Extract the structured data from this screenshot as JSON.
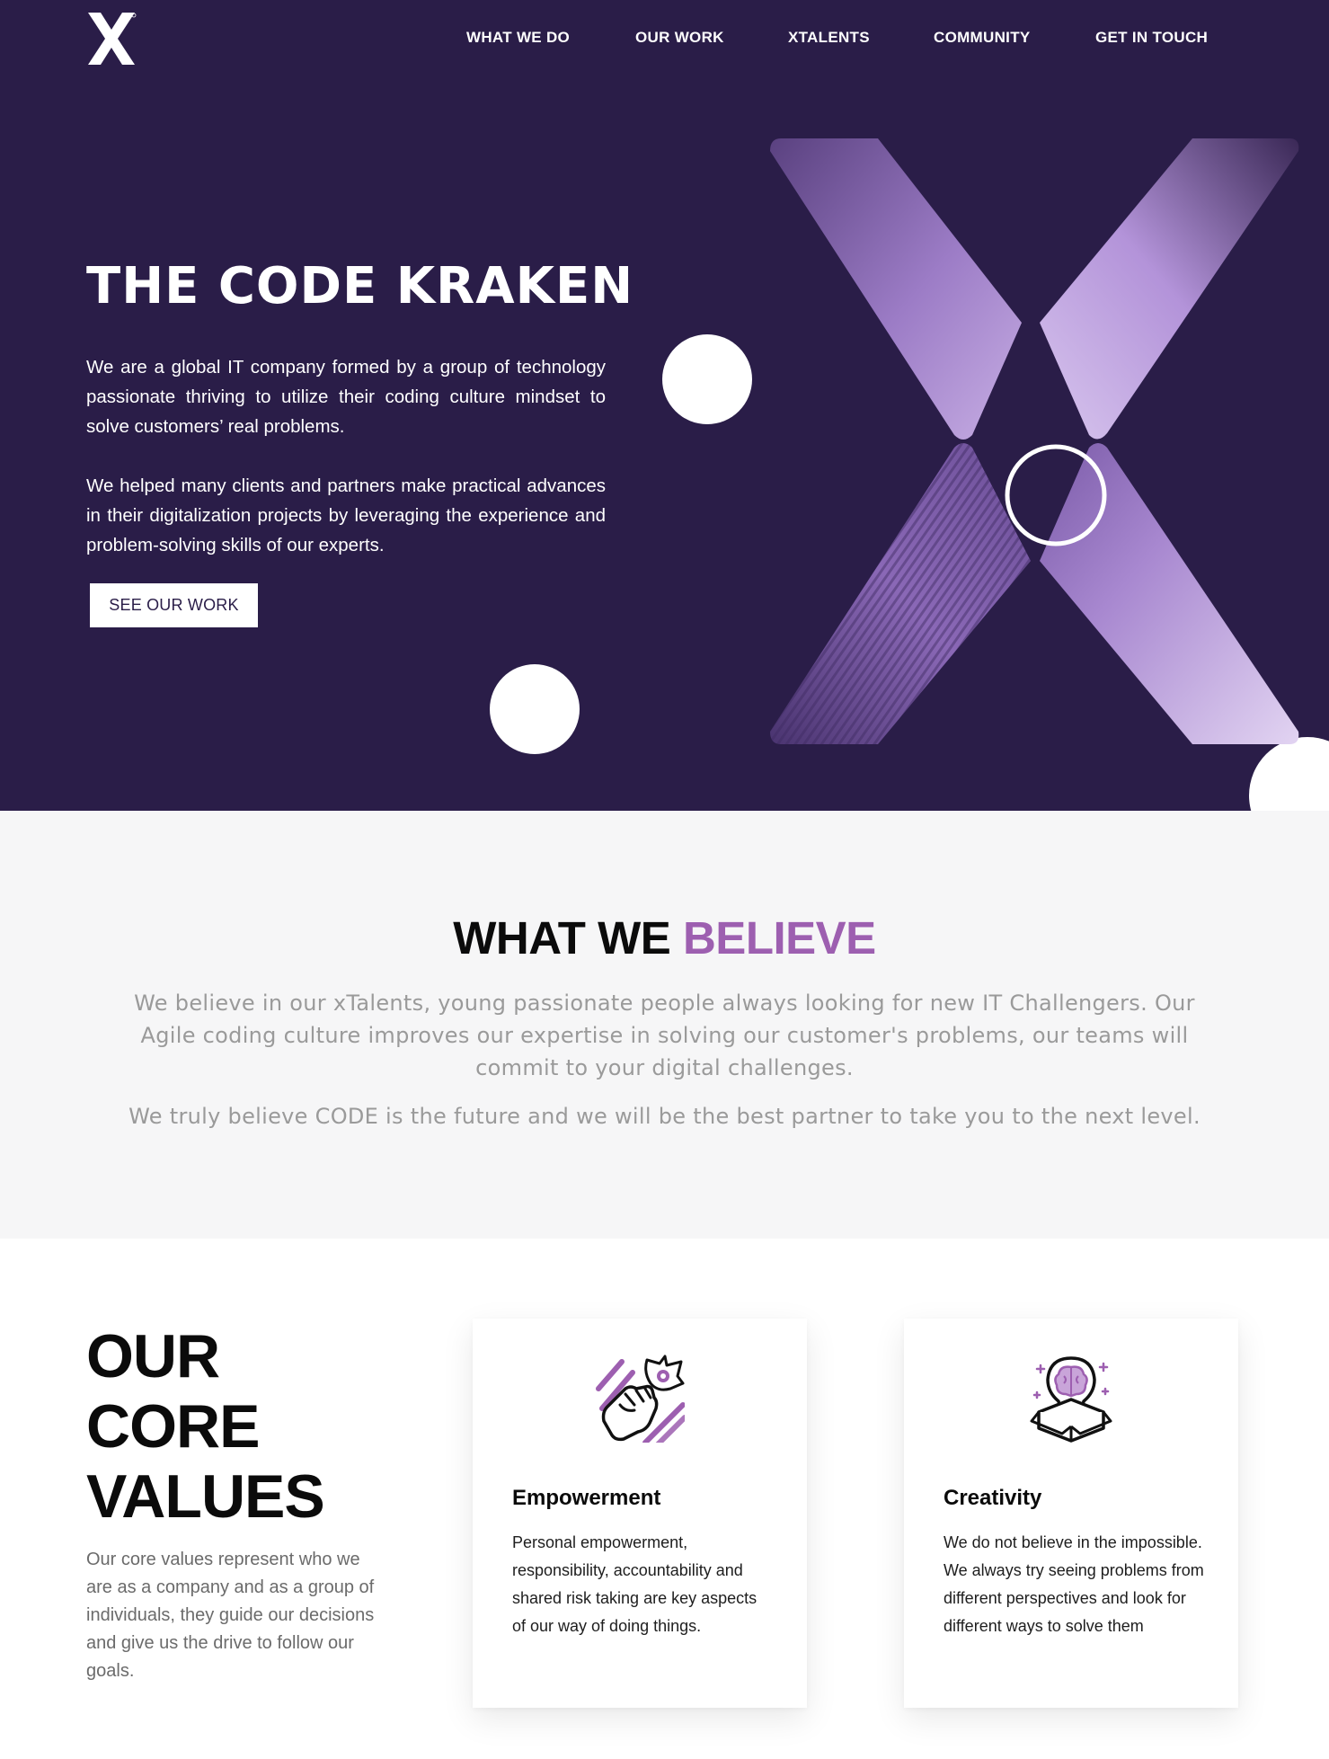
{
  "nav": {
    "items": [
      {
        "label": "WHAT WE DO"
      },
      {
        "label": "OUR WORK"
      },
      {
        "label": "XTALENTS"
      },
      {
        "label": "COMMUNITY"
      },
      {
        "label": "GET IN TOUCH"
      }
    ]
  },
  "hero": {
    "title": "THE CODE KRAKEN",
    "paragraph1": "We are a global IT company formed by a group of technology passionate thriving to utilize their coding culture mindset to solve customers’ real problems.",
    "paragraph2": "We helped many clients and partners make practical advances in their digitalization projects by leveraging the experience and problem-solving skills of our experts.",
    "cta_label": "SEE OUR WORK"
  },
  "believe": {
    "title_part1": "WHAT WE ",
    "title_part2": "BELIEVE",
    "paragraph1": "We believe in our xTalents, young passionate people always looking for new IT Challengers. Our Agile coding culture improves our expertise in solving our customer's problems, our teams will commit to your digital challenges.",
    "paragraph2": "We truly believe CODE is the future and we will be the best partner to take you to the next level."
  },
  "values": {
    "title_line1": "OUR",
    "title_line2": "CORE",
    "title_line3": "VALUES",
    "description": "Our core values represent who we are as a company and as a group of individuals, they guide our decisions and give us the drive to follow our goals.",
    "cards": [
      {
        "icon": "fist-rocket-icon",
        "title": "Empowerment",
        "text": "Personal empowerment, responsibility, accountability and shared risk taking are key aspects of our way of doing things."
      },
      {
        "icon": "brain-lightbulb-box-icon",
        "title": "Creativity",
        "text": "We do not believe in the impossible. We always try seeing problems from different perspectives and look for different ways to solve them"
      }
    ]
  },
  "colors": {
    "hero_bg": "#2a1d48",
    "accent": "#9d5fb0",
    "believe_bg": "#f6f6f7"
  }
}
